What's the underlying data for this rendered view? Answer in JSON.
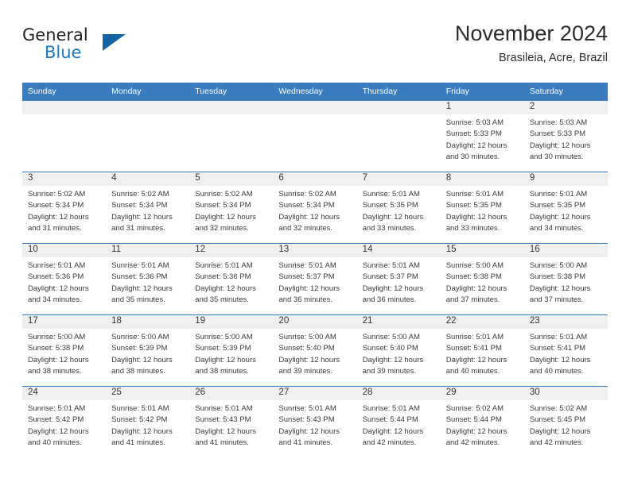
{
  "brand": {
    "general_text": "General",
    "blue_text": "Blue",
    "triangle_icon": "triangle-icon"
  },
  "header": {
    "month_title": "November 2024",
    "location": "Brasileia, Acre, Brazil"
  },
  "calendar": {
    "weekday_headers": [
      "Sunday",
      "Monday",
      "Tuesday",
      "Wednesday",
      "Thursday",
      "Friday",
      "Saturday"
    ],
    "accent_color": "#3a7cbe",
    "daynum_band_color": "#f0f0f0",
    "weeks": [
      [
        {
          "day": "",
          "empty": true
        },
        {
          "day": "",
          "empty": true
        },
        {
          "day": "",
          "empty": true
        },
        {
          "day": "",
          "empty": true
        },
        {
          "day": "",
          "empty": true
        },
        {
          "day": "1",
          "sunrise": "Sunrise: 5:03 AM",
          "sunset": "Sunset: 5:33 PM",
          "daylight": "Daylight: 12 hours and 30 minutes."
        },
        {
          "day": "2",
          "sunrise": "Sunrise: 5:03 AM",
          "sunset": "Sunset: 5:33 PM",
          "daylight": "Daylight: 12 hours and 30 minutes."
        }
      ],
      [
        {
          "day": "3",
          "sunrise": "Sunrise: 5:02 AM",
          "sunset": "Sunset: 5:34 PM",
          "daylight": "Daylight: 12 hours and 31 minutes."
        },
        {
          "day": "4",
          "sunrise": "Sunrise: 5:02 AM",
          "sunset": "Sunset: 5:34 PM",
          "daylight": "Daylight: 12 hours and 31 minutes."
        },
        {
          "day": "5",
          "sunrise": "Sunrise: 5:02 AM",
          "sunset": "Sunset: 5:34 PM",
          "daylight": "Daylight: 12 hours and 32 minutes."
        },
        {
          "day": "6",
          "sunrise": "Sunrise: 5:02 AM",
          "sunset": "Sunset: 5:34 PM",
          "daylight": "Daylight: 12 hours and 32 minutes."
        },
        {
          "day": "7",
          "sunrise": "Sunrise: 5:01 AM",
          "sunset": "Sunset: 5:35 PM",
          "daylight": "Daylight: 12 hours and 33 minutes."
        },
        {
          "day": "8",
          "sunrise": "Sunrise: 5:01 AM",
          "sunset": "Sunset: 5:35 PM",
          "daylight": "Daylight: 12 hours and 33 minutes."
        },
        {
          "day": "9",
          "sunrise": "Sunrise: 5:01 AM",
          "sunset": "Sunset: 5:35 PM",
          "daylight": "Daylight: 12 hours and 34 minutes."
        }
      ],
      [
        {
          "day": "10",
          "sunrise": "Sunrise: 5:01 AM",
          "sunset": "Sunset: 5:36 PM",
          "daylight": "Daylight: 12 hours and 34 minutes."
        },
        {
          "day": "11",
          "sunrise": "Sunrise: 5:01 AM",
          "sunset": "Sunset: 5:36 PM",
          "daylight": "Daylight: 12 hours and 35 minutes."
        },
        {
          "day": "12",
          "sunrise": "Sunrise: 5:01 AM",
          "sunset": "Sunset: 5:36 PM",
          "daylight": "Daylight: 12 hours and 35 minutes."
        },
        {
          "day": "13",
          "sunrise": "Sunrise: 5:01 AM",
          "sunset": "Sunset: 5:37 PM",
          "daylight": "Daylight: 12 hours and 36 minutes."
        },
        {
          "day": "14",
          "sunrise": "Sunrise: 5:01 AM",
          "sunset": "Sunset: 5:37 PM",
          "daylight": "Daylight: 12 hours and 36 minutes."
        },
        {
          "day": "15",
          "sunrise": "Sunrise: 5:00 AM",
          "sunset": "Sunset: 5:38 PM",
          "daylight": "Daylight: 12 hours and 37 minutes."
        },
        {
          "day": "16",
          "sunrise": "Sunrise: 5:00 AM",
          "sunset": "Sunset: 5:38 PM",
          "daylight": "Daylight: 12 hours and 37 minutes."
        }
      ],
      [
        {
          "day": "17",
          "sunrise": "Sunrise: 5:00 AM",
          "sunset": "Sunset: 5:38 PM",
          "daylight": "Daylight: 12 hours and 38 minutes."
        },
        {
          "day": "18",
          "sunrise": "Sunrise: 5:00 AM",
          "sunset": "Sunset: 5:39 PM",
          "daylight": "Daylight: 12 hours and 38 minutes."
        },
        {
          "day": "19",
          "sunrise": "Sunrise: 5:00 AM",
          "sunset": "Sunset: 5:39 PM",
          "daylight": "Daylight: 12 hours and 38 minutes."
        },
        {
          "day": "20",
          "sunrise": "Sunrise: 5:00 AM",
          "sunset": "Sunset: 5:40 PM",
          "daylight": "Daylight: 12 hours and 39 minutes."
        },
        {
          "day": "21",
          "sunrise": "Sunrise: 5:00 AM",
          "sunset": "Sunset: 5:40 PM",
          "daylight": "Daylight: 12 hours and 39 minutes."
        },
        {
          "day": "22",
          "sunrise": "Sunrise: 5:01 AM",
          "sunset": "Sunset: 5:41 PM",
          "daylight": "Daylight: 12 hours and 40 minutes."
        },
        {
          "day": "23",
          "sunrise": "Sunrise: 5:01 AM",
          "sunset": "Sunset: 5:41 PM",
          "daylight": "Daylight: 12 hours and 40 minutes."
        }
      ],
      [
        {
          "day": "24",
          "sunrise": "Sunrise: 5:01 AM",
          "sunset": "Sunset: 5:42 PM",
          "daylight": "Daylight: 12 hours and 40 minutes."
        },
        {
          "day": "25",
          "sunrise": "Sunrise: 5:01 AM",
          "sunset": "Sunset: 5:42 PM",
          "daylight": "Daylight: 12 hours and 41 minutes."
        },
        {
          "day": "26",
          "sunrise": "Sunrise: 5:01 AM",
          "sunset": "Sunset: 5:43 PM",
          "daylight": "Daylight: 12 hours and 41 minutes."
        },
        {
          "day": "27",
          "sunrise": "Sunrise: 5:01 AM",
          "sunset": "Sunset: 5:43 PM",
          "daylight": "Daylight: 12 hours and 41 minutes."
        },
        {
          "day": "28",
          "sunrise": "Sunrise: 5:01 AM",
          "sunset": "Sunset: 5:44 PM",
          "daylight": "Daylight: 12 hours and 42 minutes."
        },
        {
          "day": "29",
          "sunrise": "Sunrise: 5:02 AM",
          "sunset": "Sunset: 5:44 PM",
          "daylight": "Daylight: 12 hours and 42 minutes."
        },
        {
          "day": "30",
          "sunrise": "Sunrise: 5:02 AM",
          "sunset": "Sunset: 5:45 PM",
          "daylight": "Daylight: 12 hours and 42 minutes."
        }
      ]
    ]
  }
}
